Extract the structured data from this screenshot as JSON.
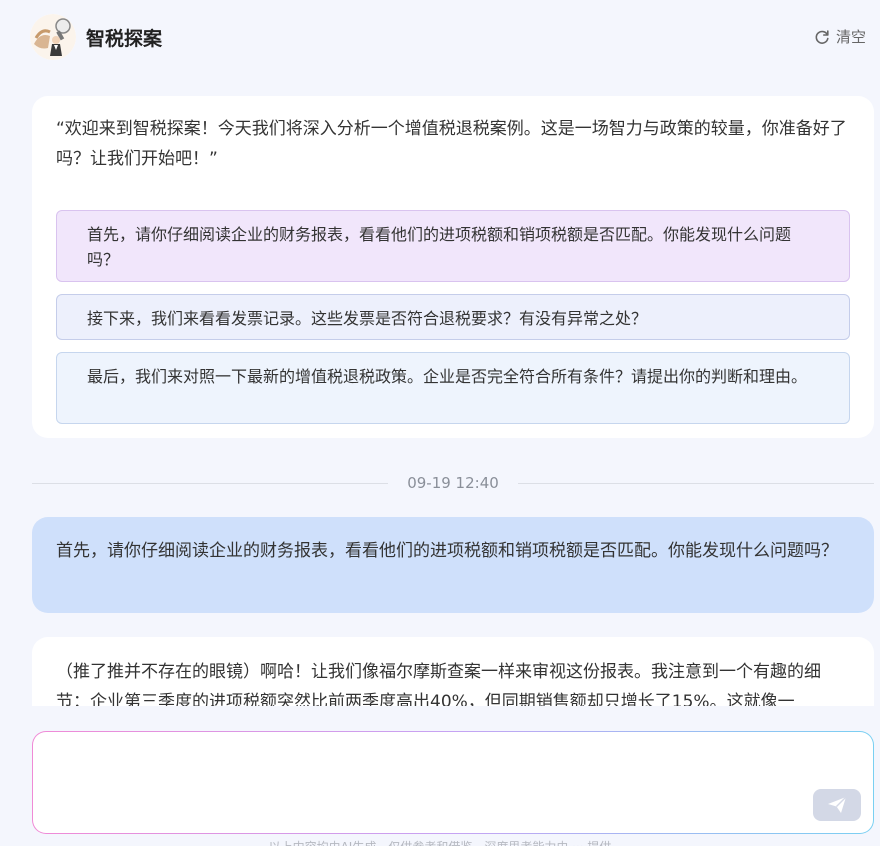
{
  "header": {
    "app_title": "智税探案",
    "clear_label": "清空"
  },
  "welcome": {
    "text": "“欢迎来到智税探案！今天我们将深入分析一个增值税退税案例。这是一场智力与政策的较量，你准备好了吗？让我们开始吧！”",
    "suggestions": [
      "首先，请你仔细阅读企业的财务报表，看看他们的进项税额和销项税额是否匹配。你能发现什么问题吗？",
      "接下来，我们来看看发票记录。这些发票是否符合退税要求？有没有异常之处？",
      "最后，我们来对照一下最新的增值税退税政策。企业是否完全符合所有条件？请提出你的判断和理由。"
    ]
  },
  "timestamp": "09-19 12:40",
  "user_message": "首先，请你仔细阅读企业的财务报表，看看他们的进项税额和销项税额是否匹配。你能发现什么问题吗？",
  "bot_message": "（推了推并不存在的眼镜）啊哈！让我们像福尔摩斯查案一样来审视这份报表。我注意到一个有趣的细节：企业第三季度的进项税额突然比前两季度高出40%，但同期销售额却只增长了15%。这就像一",
  "input": {
    "placeholder": ""
  },
  "footer": "以上内容均由AI生成，仅供参考和借鉴。深度思考能力由 ··· 提供"
}
